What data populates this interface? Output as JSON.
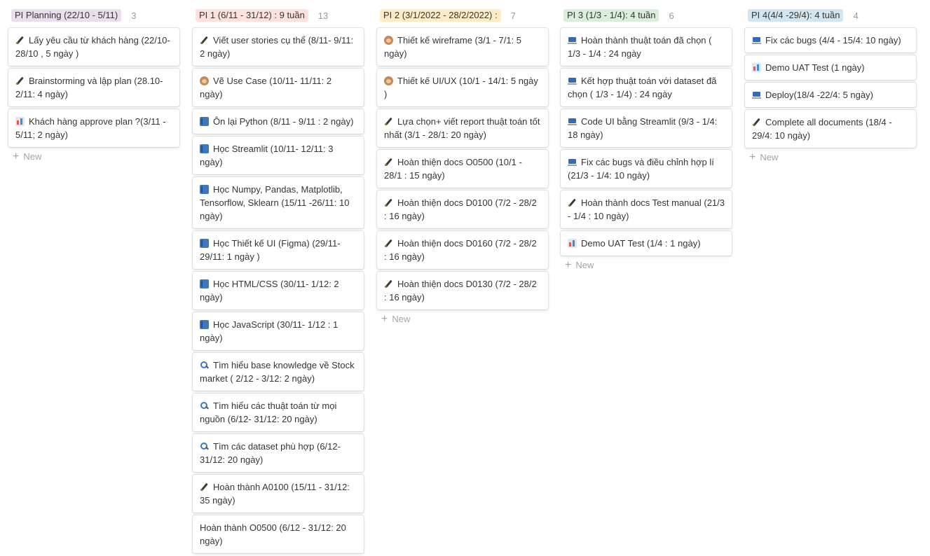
{
  "columns": [
    {
      "title": "PI Planning (22/10 - 5/11)",
      "count": "3",
      "bg": "#e8deee",
      "cards": [
        {
          "icon": "feather-icon",
          "text": "Lấy yêu cầu từ khách hàng (22/10- 28/10 , 5 ngày )"
        },
        {
          "icon": "feather-icon",
          "text": "Brainstorming và lập plan (28.10-2/11: 4 ngày)"
        },
        {
          "icon": "bar-chart-icon",
          "text": "Khách hàng approve plan ?(3/11 - 5/11; 2 ngày)"
        }
      ],
      "new_label": "New"
    },
    {
      "title": "PI 1 (6/11 - 31/12) : 9 tuần",
      "count": "13",
      "bg": "#ffe2dd",
      "cards": [
        {
          "icon": "feather-icon",
          "text": "Viết user stories cụ thể (8/11- 9/11: 2 ngày)"
        },
        {
          "icon": "monkey-icon",
          "text": "Vẽ Use Case (10/11- 11/11: 2 ngày)"
        },
        {
          "icon": "book-icon",
          "text": "Ôn lại Python (8/11 - 9/11 : 2 ngày)"
        },
        {
          "icon": "book-icon",
          "text": "Học Streamlit (10/11- 12/11: 3 ngày)"
        },
        {
          "icon": "book-icon",
          "text": "Học Numpy, Pandas, Matplotlib, Tensorflow, Sklearn (15/11 -26/11: 10 ngày)"
        },
        {
          "icon": "book-icon",
          "text": "Học Thiết kế UI (Figma) (29/11- 29/11: 1 ngày )"
        },
        {
          "icon": "book-icon",
          "text": "Học HTML/CSS (30/11-  1/12: 2 ngày)"
        },
        {
          "icon": "book-icon",
          "text": "Học JavaScript (30/11- 1/12 : 1 ngày)"
        },
        {
          "icon": "magnifier-icon",
          "text": "Tìm hiểu base knowledge về Stock market ( 2/12 - 3/12: 2 ngày)"
        },
        {
          "icon": "magnifier-icon",
          "text": "Tìm hiểu các thuật toán  từ mọi nguồn (6/12- 31/12:  20 ngày)"
        },
        {
          "icon": "magnifier-icon",
          "text": "Tìm các dataset phù hợp (6/12- 31/12: 20 ngày)"
        },
        {
          "icon": "feather-icon",
          "text": "Hoàn thành A0100 (15/11 - 31/12: 35 ngày)"
        },
        {
          "icon": "",
          "text": "Hoàn thành O0500 (6/12 - 31/12: 20 ngày)"
        }
      ],
      "new_label": ""
    },
    {
      "title": "PI 2 (3/1/2022 - 28/2/2022) :",
      "count": "7",
      "bg": "#fdecc8",
      "cards": [
        {
          "icon": "monkey-icon",
          "text": "Thiết kế wireframe (3/1 - 7/1: 5 ngày)"
        },
        {
          "icon": "monkey-icon",
          "text": "Thiết kế UI/UX (10/1 - 14/1: 5 ngày )"
        },
        {
          "icon": "feather-icon",
          "text": "Lựa chọn+ viết report thuật toán tốt nhất (3/1 - 28/1: 20 ngày)"
        },
        {
          "icon": "feather-icon",
          "text": "Hoàn thiện docs O0500 (10/1 - 28/1 : 15 ngày)"
        },
        {
          "icon": "feather-icon",
          "text": "Hoàn thiện  docs D0100 (7/2 - 28/2 : 16 ngày)"
        },
        {
          "icon": "feather-icon",
          "text": "Hoàn thiện docs D0160 (7/2 - 28/2 : 16 ngày)"
        },
        {
          "icon": "feather-icon",
          "text": "Hoàn thiện  docs D0130 (7/2 - 28/2 : 16 ngày)"
        }
      ],
      "new_label": "New"
    },
    {
      "title": "PI 3 (1/3 - 1/4): 4 tuần",
      "count": "6",
      "bg": "#dbeddb",
      "cards": [
        {
          "icon": "laptop-icon",
          "text": "Hoàn thành thuật toán đã chọn ( 1/3 - 1/4 : 24 ngày"
        },
        {
          "icon": "laptop-icon",
          "text": "Kết hợp thuật toán với dataset đã chọn ( 1/3 - 1/4) : 24 ngày"
        },
        {
          "icon": "laptop-icon",
          "text": "Code UI bằng Streamlit (9/3 - 1/4: 18 ngày)"
        },
        {
          "icon": "laptop-icon",
          "text": "Fix các bugs và điều chỉnh hợp lí (21/3 - 1/4: 10 ngày)"
        },
        {
          "icon": "feather-icon",
          "text": "Hoàn thành docs Test manual (21/3 - 1/4 : 10 ngày)"
        },
        {
          "icon": "bar-chart-icon",
          "text": "Demo UAT Test (1/4 : 1 ngày)"
        }
      ],
      "new_label": "New"
    },
    {
      "title": "PI 4(4/4 -29/4): 4 tuần",
      "count": "4",
      "bg": "#d3e5ef",
      "cards": [
        {
          "icon": "laptop-icon",
          "text": "Fix các bugs (4/4 - 15/4: 10 ngày)"
        },
        {
          "icon": "bar-chart-icon",
          "text": "Demo UAT Test (1 ngày)"
        },
        {
          "icon": "laptop-icon",
          "text": "Deploy(18/4 -22/4: 5 ngày)"
        },
        {
          "icon": "feather-icon",
          "text": "Complete all documents (18/4 - 29/4: 10 ngày)"
        }
      ],
      "new_label": "New"
    }
  ]
}
